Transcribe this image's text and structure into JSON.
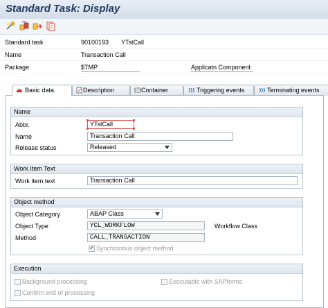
{
  "window": {
    "title": "Standard Task: Display"
  },
  "toolbar": {
    "icons": [
      "other-object-icon",
      "display-change-icon",
      "where-used-icon",
      "copy-icon"
    ]
  },
  "header": {
    "standard_task_label": "Standard task",
    "standard_task_number": "90100193",
    "standard_task_abbr": "YTstCall",
    "name_label": "Name",
    "name_value": "Transaction Call",
    "package_label": "Package",
    "package_value": "$TMP",
    "app_component_label": "Applicatn Component"
  },
  "tabs": [
    {
      "label": "Basic data",
      "icon": "basic-data-icon",
      "active": true
    },
    {
      "label": "Description",
      "icon": "description-icon",
      "active": false
    },
    {
      "label": "Container",
      "icon": "container-icon",
      "active": false
    },
    {
      "label": "Triggering events",
      "icon": "event-icon",
      "active": false
    },
    {
      "label": "Terminating events",
      "icon": "event-icon",
      "active": false
    }
  ],
  "name_group": {
    "title": "Name",
    "abbr_label": "Abbr.",
    "abbr_value": "YTstCall",
    "name_label": "Name",
    "name_value": "Transaction Call",
    "release_label": "Release status",
    "release_value": "Released"
  },
  "work_item_group": {
    "title": "Work Item Text",
    "text_label": "Work item text",
    "text_value": "Transaction Call"
  },
  "object_method_group": {
    "title": "Object method",
    "category_label": "Object Category",
    "category_value": "ABAP Class",
    "type_label": "Object Type",
    "type_value": "YCL_WORKFLOW",
    "type_desc": "Workflow Class",
    "method_label": "Method",
    "method_value": "CALL_TRANSACTION",
    "sync_label": "Synchronous object method",
    "sync_checked": true
  },
  "execution_group": {
    "title": "Execution",
    "background_label": "Background processing",
    "sapforms_label": "Executable with SAPforms",
    "confirm_label": "Confirm end of processing"
  },
  "colors": {
    "title": "#1f3b60",
    "tab_border": "#a9b7c6",
    "group_header": "#dfe6ee",
    "focus_border": "#d9534f"
  }
}
